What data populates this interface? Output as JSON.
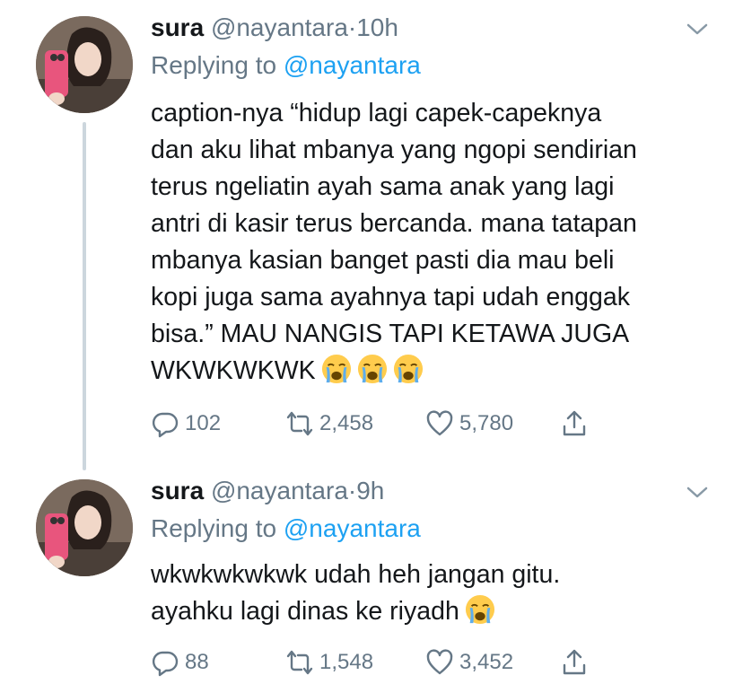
{
  "tweets": [
    {
      "name": "sura",
      "handle": "@nayantara",
      "separator": "·",
      "time": "10h",
      "reply_prefix": "Replying to",
      "reply_mention": "@nayantara",
      "body_lines": [
        "caption-nya “hidup lagi capek-capeknya",
        "dan aku lihat mbanya yang ngopi sendirian",
        "terus ngeliatin ayah sama anak yang lagi",
        "antri di kasir terus bercanda. mana tatapan",
        "mbanya kasian banget pasti dia mau beli",
        "kopi juga sama ayahnya tapi udah enggak",
        "bisa.” MAU NANGIS TAPI KETAWA JUGA",
        "WKWKWKWK"
      ],
      "emoji_count": 3,
      "replies": "102",
      "retweets": "2,458",
      "likes": "5,780"
    },
    {
      "name": "sura",
      "handle": "@nayantara",
      "separator": "·",
      "time": "9h",
      "reply_prefix": "Replying to",
      "reply_mention": "@nayantara",
      "body_lines": [
        "wkwkwkwkwk udah heh jangan gitu.",
        "ayahku lagi dinas ke riyadh"
      ],
      "emoji_count": 1,
      "replies": "88",
      "retweets": "1,548",
      "likes": "3,452"
    }
  ],
  "colors": {
    "text": "#14171a",
    "secondary": "#657786",
    "link": "#1da1f2",
    "thread_line": "#ccd6dd"
  },
  "icons": [
    "reply-icon",
    "retweet-icon",
    "like-icon",
    "share-icon",
    "chevron-down-icon",
    "loudly-crying-face-emoji"
  ]
}
